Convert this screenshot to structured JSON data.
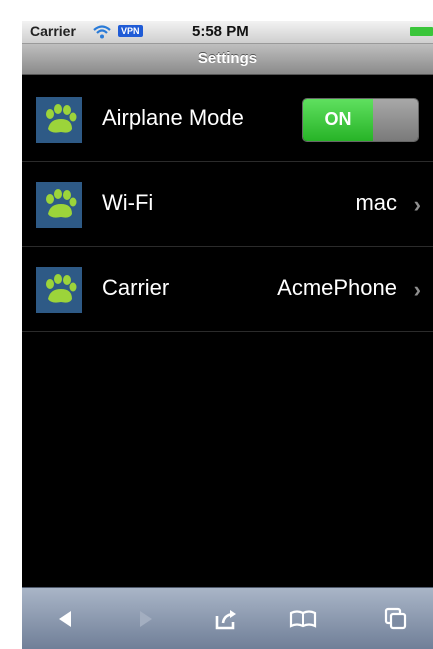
{
  "status_bar": {
    "carrier": "Carrier",
    "vpn": "VPN",
    "time": "5:58 PM"
  },
  "nav": {
    "title": "Settings"
  },
  "rows": [
    {
      "label": "Airplane Mode",
      "toggle_text": "ON",
      "icon": "paw-icon"
    },
    {
      "label": "Wi-Fi",
      "value": "mac",
      "icon": "paw-icon"
    },
    {
      "label": "Carrier",
      "value": "AcmePhone",
      "icon": "paw-icon"
    }
  ],
  "toolbar": {
    "buttons": [
      "back-icon",
      "forward-icon",
      "share-icon",
      "bookmarks-icon",
      "tabs-icon"
    ]
  },
  "colors": {
    "toggle_on": "#27b327",
    "icon_bg": "#2e5a86",
    "paw": "#9cd43a"
  }
}
